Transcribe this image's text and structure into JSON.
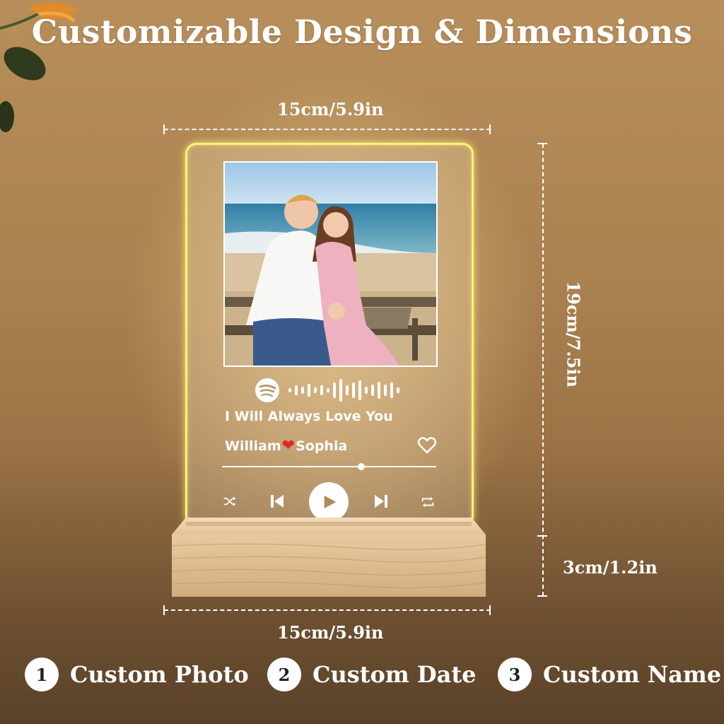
{
  "title": "Customizable Design & Dimensions",
  "dimensions": {
    "top_width": "15cm/5.9in",
    "height": "19cm/7.5in",
    "base_height": "3cm/1.2in",
    "bottom_width": "15cm/5.9in"
  },
  "plaque": {
    "song_title": "I Will Always Love You",
    "name_left": "William",
    "heart_glyph": "❤",
    "name_right": "Sophia",
    "progress": 0.65,
    "glow_color": "#fff27a"
  },
  "controls": [
    "shuffle-icon",
    "previous-icon",
    "play-icon",
    "next-icon",
    "repeat-icon"
  ],
  "features": [
    {
      "number": "1",
      "label": "Custom Photo"
    },
    {
      "number": "2",
      "label": "Custom Date"
    },
    {
      "number": "3",
      "label": "Custom Name"
    }
  ]
}
